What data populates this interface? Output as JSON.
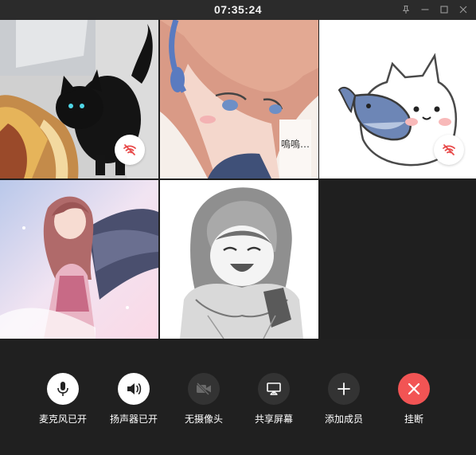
{
  "titlebar": {
    "timer": "07:35:24",
    "buttons": [
      {
        "name": "pin-icon"
      },
      {
        "name": "minimize-icon"
      },
      {
        "name": "maximize-icon"
      },
      {
        "name": "close-icon"
      }
    ]
  },
  "participants": [
    {
      "avatar": "black-kitten-photo",
      "network_warning": true
    },
    {
      "avatar": "anime-girl-headphones-illustration",
      "network_warning": false,
      "caption": "嗚嗚…"
    },
    {
      "avatar": "cat-holding-fish-sticker",
      "network_warning": true
    },
    {
      "avatar": "winged-anime-girl-illustration",
      "network_warning": false
    },
    {
      "avatar": "manga-girl-laughing-sketch",
      "network_warning": false
    }
  ],
  "controls": {
    "mic": {
      "label": "麦克风已开",
      "icon": "microphone-icon",
      "state": "on"
    },
    "speaker": {
      "label": "扬声器已开",
      "icon": "speaker-icon",
      "state": "on"
    },
    "camera": {
      "label": "无摄像头",
      "icon": "camera-off-icon",
      "state": "unavailable"
    },
    "share": {
      "label": "共享屏幕",
      "icon": "screen-share-icon"
    },
    "add": {
      "label": "添加成员",
      "icon": "plus-icon"
    },
    "hangup": {
      "label": "挂断",
      "icon": "hangup-x-icon"
    }
  },
  "colors": {
    "background": "#2b2b2b",
    "control_bar": "#202020",
    "hangup": "#f25454",
    "network_warning": "#e84a4a"
  }
}
